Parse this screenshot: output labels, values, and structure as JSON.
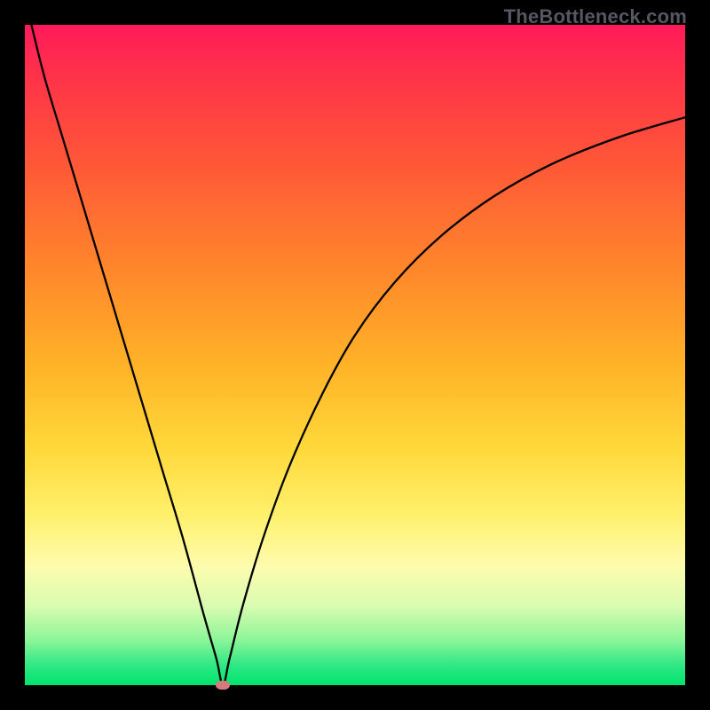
{
  "watermark": "TheBottleneck.com",
  "chart_data": {
    "type": "line",
    "title": "",
    "xlabel": "",
    "ylabel": "",
    "xlim": [
      0,
      100
    ],
    "ylim": [
      0,
      100
    ],
    "grid": false,
    "legend": false,
    "background_gradient": {
      "direction": "top-to-bottom",
      "stops": [
        {
          "pos": 0,
          "color": "#ff1a5a"
        },
        {
          "pos": 22,
          "color": "#ff5a36"
        },
        {
          "pos": 52,
          "color": "#ffb428"
        },
        {
          "pos": 74,
          "color": "#fff06a"
        },
        {
          "pos": 88,
          "color": "#d9fcb0"
        },
        {
          "pos": 100,
          "color": "#00e46e"
        }
      ]
    },
    "series": [
      {
        "name": "bottleneck-curve",
        "color": "#000000",
        "x": [
          1,
          3,
          6,
          9,
          12,
          15,
          18,
          21,
          24,
          27,
          29,
          30,
          31,
          33,
          36,
          40,
          45,
          50,
          56,
          63,
          71,
          80,
          90,
          100
        ],
        "y": [
          100,
          92,
          82,
          72,
          62,
          52,
          42,
          32,
          22,
          11,
          4,
          0,
          4,
          12,
          22,
          33,
          44,
          53,
          61,
          68,
          74,
          79,
          83,
          86
        ]
      }
    ],
    "minimum_marker": {
      "x": 30,
      "y": 0,
      "color": "#d77a7e"
    }
  }
}
